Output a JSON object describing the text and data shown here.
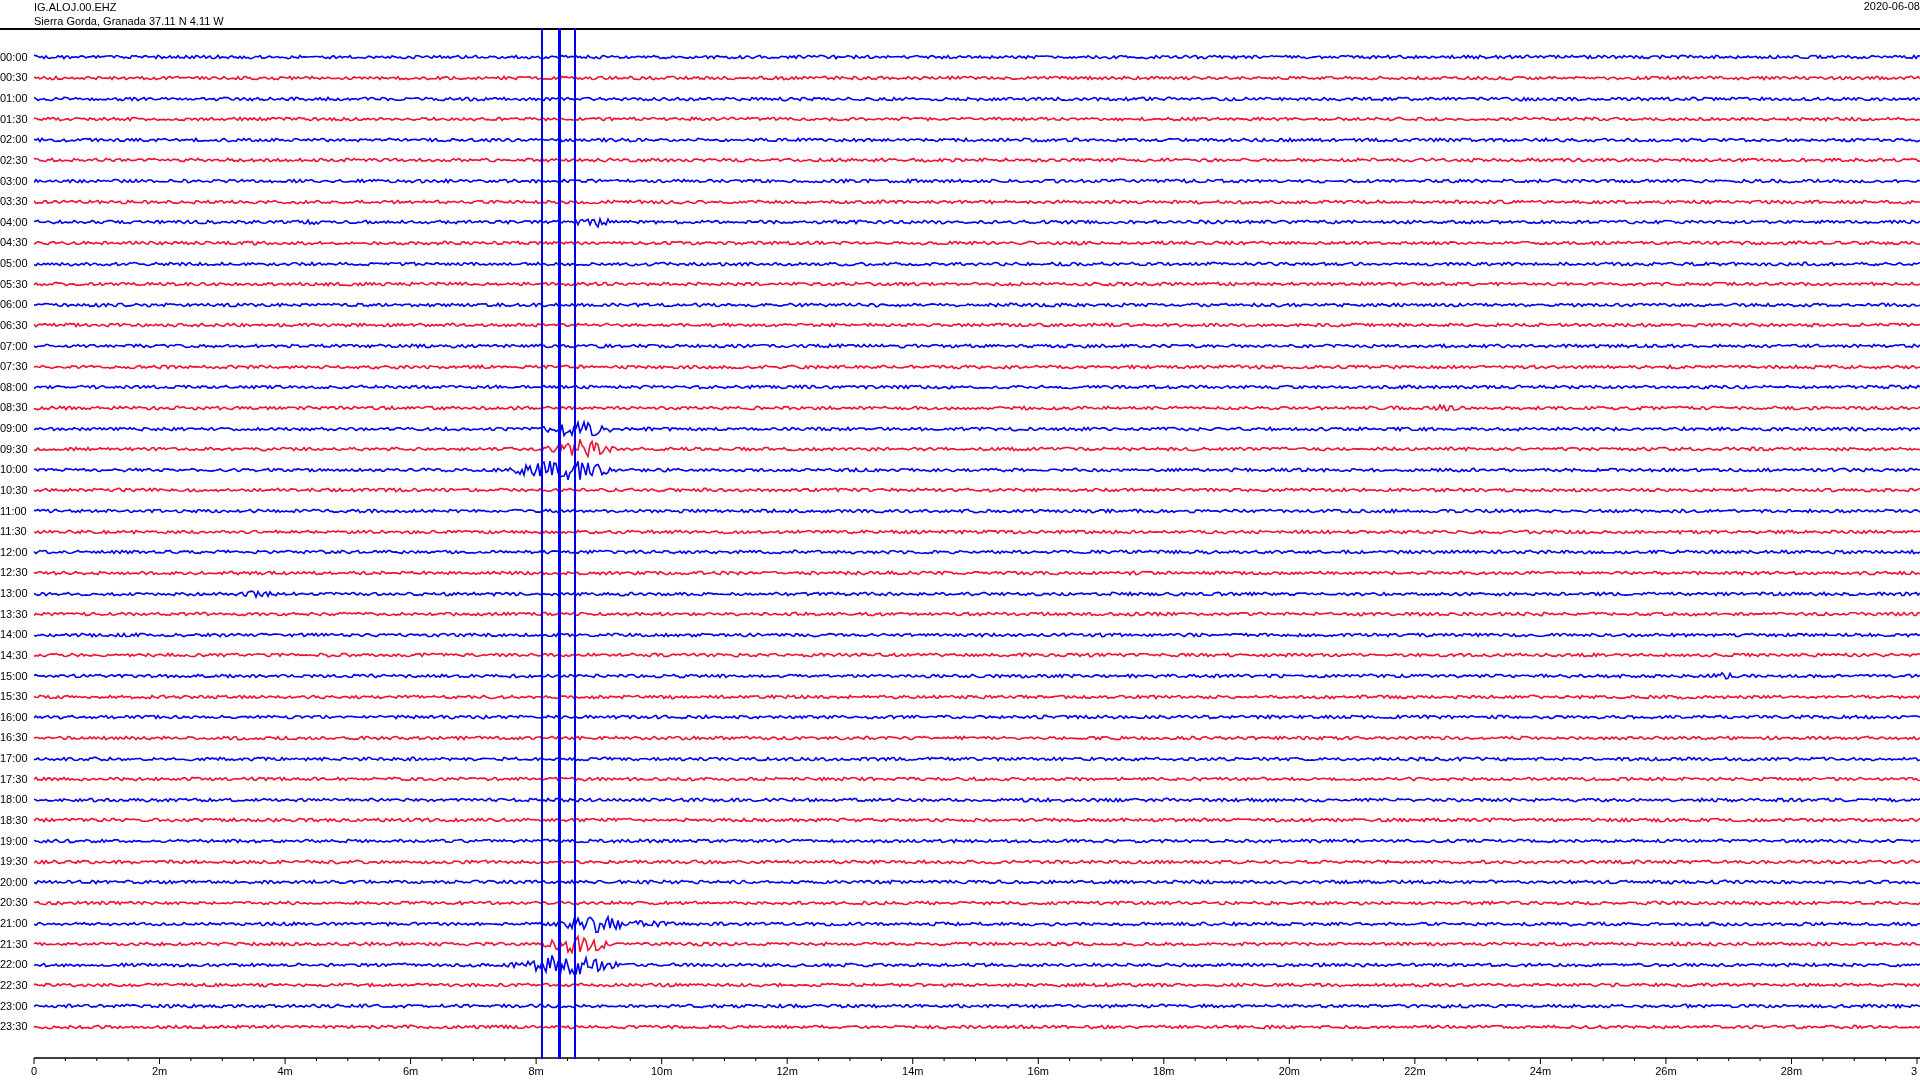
{
  "header": {
    "station": "IG.ALOJ.00.EHZ",
    "location": "Sierra Gorda, Granada  37.11 N 4.11 W",
    "date": "2020-06-08"
  },
  "rows": [
    {
      "time": "00:00",
      "color": "#0000ee"
    },
    {
      "time": "00:30",
      "color": "#ee1133"
    },
    {
      "time": "01:00",
      "color": "#0000ee"
    },
    {
      "time": "01:30",
      "color": "#ee1133"
    },
    {
      "time": "02:00",
      "color": "#0000ee"
    },
    {
      "time": "02:30",
      "color": "#ee1133"
    },
    {
      "time": "03:00",
      "color": "#0000ee"
    },
    {
      "time": "03:30",
      "color": "#ee1133"
    },
    {
      "time": "04:00",
      "color": "#0000ee"
    },
    {
      "time": "04:30",
      "color": "#ee1133"
    },
    {
      "time": "05:00",
      "color": "#0000ee"
    },
    {
      "time": "05:30",
      "color": "#ee1133"
    },
    {
      "time": "06:00",
      "color": "#0000ee"
    },
    {
      "time": "06:30",
      "color": "#ee1133"
    },
    {
      "time": "07:00",
      "color": "#0000ee"
    },
    {
      "time": "07:30",
      "color": "#ee1133"
    },
    {
      "time": "08:00",
      "color": "#0000ee"
    },
    {
      "time": "08:30",
      "color": "#ee1133"
    },
    {
      "time": "09:00",
      "color": "#0000ee"
    },
    {
      "time": "09:30",
      "color": "#ee1133"
    },
    {
      "time": "10:00",
      "color": "#0000ee"
    },
    {
      "time": "10:30",
      "color": "#ee1133"
    },
    {
      "time": "11:00",
      "color": "#0000ee"
    },
    {
      "time": "11:30",
      "color": "#ee1133"
    },
    {
      "time": "12:00",
      "color": "#0000ee"
    },
    {
      "time": "12:30",
      "color": "#ee1133"
    },
    {
      "time": "13:00",
      "color": "#0000ee"
    },
    {
      "time": "13:30",
      "color": "#ee1133"
    },
    {
      "time": "14:00",
      "color": "#0000ee"
    },
    {
      "time": "14:30",
      "color": "#ee1133"
    },
    {
      "time": "15:00",
      "color": "#0000ee"
    },
    {
      "time": "15:30",
      "color": "#ee1133"
    },
    {
      "time": "16:00",
      "color": "#0000ee"
    },
    {
      "time": "16:30",
      "color": "#ee1133"
    },
    {
      "time": "17:00",
      "color": "#0000ee"
    },
    {
      "time": "17:30",
      "color": "#ee1133"
    },
    {
      "time": "18:00",
      "color": "#0000ee"
    },
    {
      "time": "18:30",
      "color": "#ee1133"
    },
    {
      "time": "19:00",
      "color": "#0000ee"
    },
    {
      "time": "19:30",
      "color": "#ee1133"
    },
    {
      "time": "20:00",
      "color": "#0000ee"
    },
    {
      "time": "20:30",
      "color": "#ee1133"
    },
    {
      "time": "21:00",
      "color": "#0000ee"
    },
    {
      "time": "21:30",
      "color": "#ee1133"
    },
    {
      "time": "22:00",
      "color": "#0000ee"
    },
    {
      "time": "22:30",
      "color": "#ee1133"
    },
    {
      "time": "23:00",
      "color": "#0000ee"
    },
    {
      "time": "23:30",
      "color": "#ee1133"
    }
  ],
  "x_axis": {
    "labels": [
      "0",
      "2m",
      "4m",
      "6m",
      "8m",
      "10m",
      "12m",
      "14m",
      "16m",
      "18m",
      "20m",
      "22m",
      "24m",
      "26m",
      "28m",
      "3"
    ]
  }
}
